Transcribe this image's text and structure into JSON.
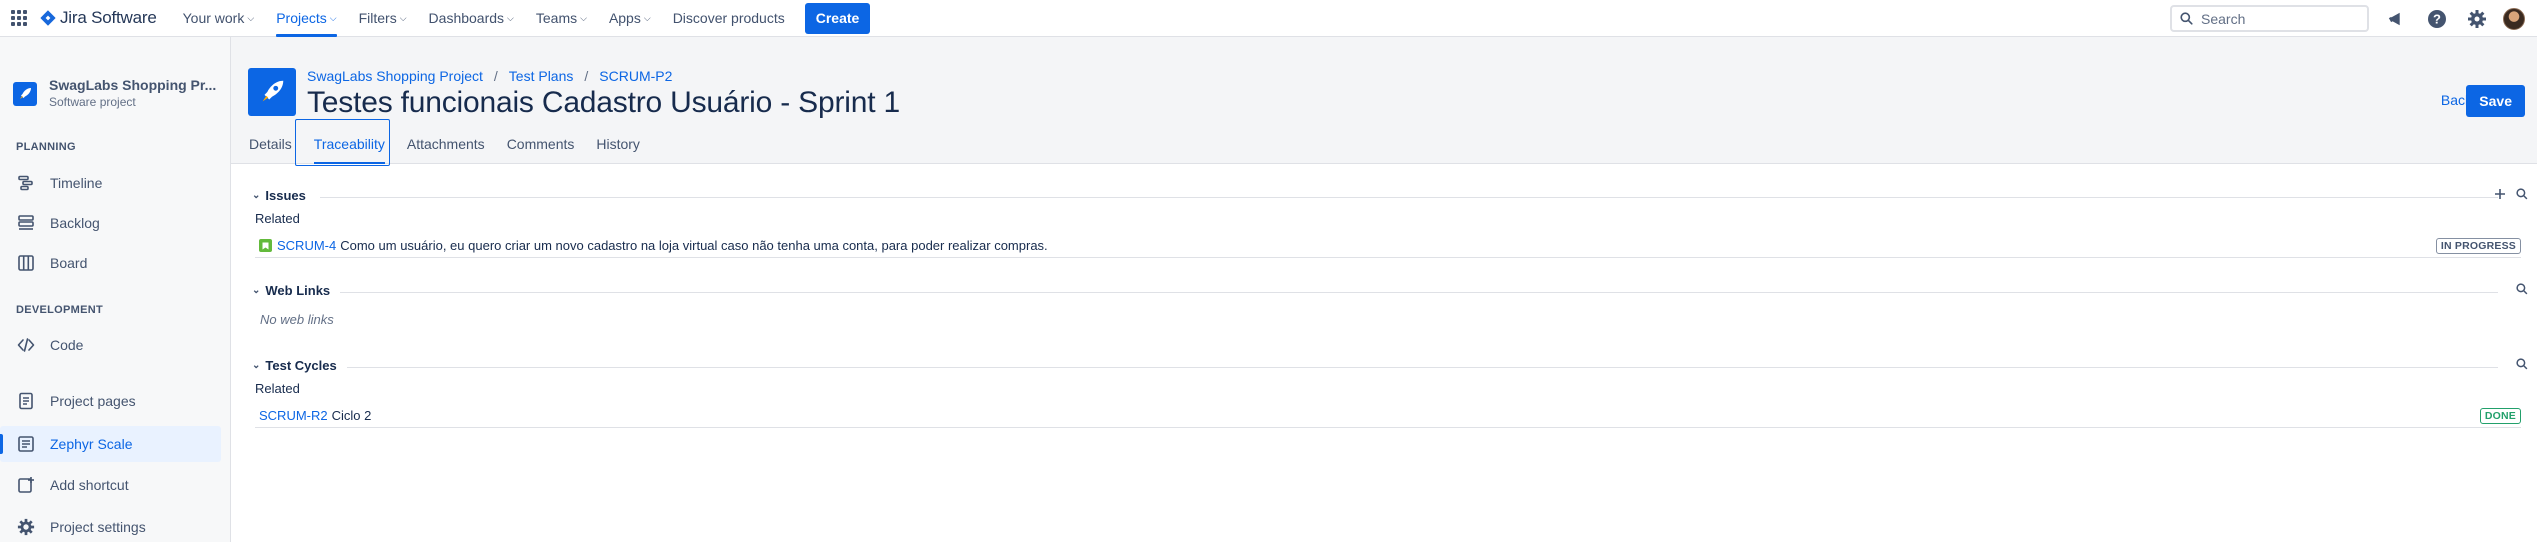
{
  "topnav": {
    "logo_text": "Jira Software",
    "items": [
      {
        "label": "Your work"
      },
      {
        "label": "Projects"
      },
      {
        "label": "Filters"
      },
      {
        "label": "Dashboards"
      },
      {
        "label": "Teams"
      },
      {
        "label": "Apps"
      },
      {
        "label": "Discover products"
      }
    ],
    "create_label": "Create",
    "search_placeholder": "Search",
    "accent": "#0c66e4"
  },
  "sidebar": {
    "project_name": "SwagLabs Shopping Pr...",
    "project_type": "Software project",
    "sections": {
      "planning": "PLANNING",
      "development": "DEVELOPMENT"
    },
    "items": [
      {
        "label": "Timeline",
        "icon": "timeline-icon"
      },
      {
        "label": "Backlog",
        "icon": "backlog-icon"
      },
      {
        "label": "Board",
        "icon": "board-icon"
      },
      {
        "label": "Code",
        "icon": "code-icon"
      },
      {
        "label": "Project pages",
        "icon": "pages-icon"
      },
      {
        "label": "Zephyr Scale",
        "icon": "zephyr-icon"
      },
      {
        "label": "Add shortcut",
        "icon": "add-shortcut-icon"
      },
      {
        "label": "Project settings",
        "icon": "settings-icon"
      }
    ]
  },
  "header": {
    "breadcrumb": [
      "SwagLabs Shopping Project",
      "Test Plans",
      "SCRUM-P2"
    ],
    "title": "Testes funcionais Cadastro Usuário - Sprint 1",
    "back_label": "Back",
    "save_label": "Save",
    "tabs": [
      {
        "label": "Details"
      },
      {
        "label": "Traceability"
      },
      {
        "label": "Attachments"
      },
      {
        "label": "Comments"
      },
      {
        "label": "History"
      }
    ]
  },
  "traceability": {
    "issues": {
      "title": "Issues",
      "sub": "Related",
      "rows": [
        {
          "key": "SCRUM-4",
          "text": "Como um usuário, eu quero criar um novo cadastro na loja virtual caso não tenha uma conta, para poder realizar compras.",
          "status": "IN PROGRESS"
        }
      ]
    },
    "web_links": {
      "title": "Web Links",
      "empty": "No web links"
    },
    "test_cycles": {
      "title": "Test Cycles",
      "sub": "Related",
      "rows": [
        {
          "key": "SCRUM-R2",
          "text": "Ciclo 2",
          "status": "DONE"
        }
      ]
    }
  }
}
